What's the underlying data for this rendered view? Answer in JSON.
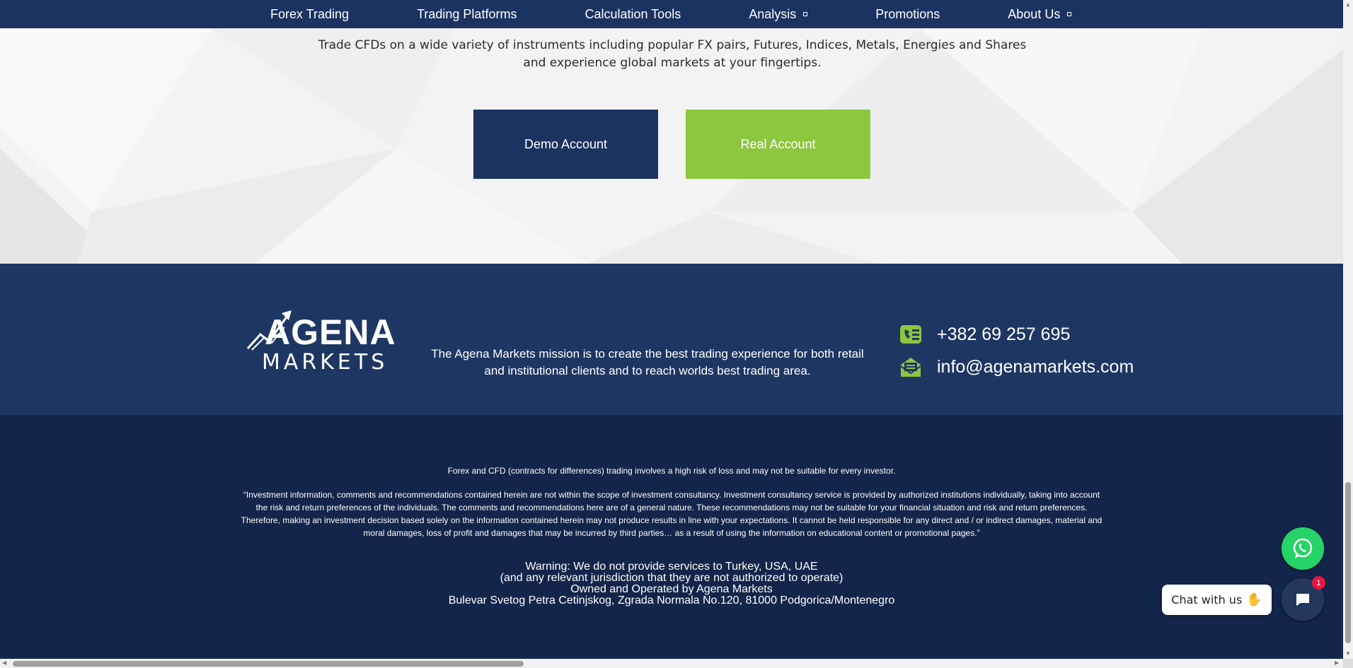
{
  "nav": {
    "items": [
      {
        "label": "Forex Trading",
        "has_dropdown": false
      },
      {
        "label": "Trading Platforms",
        "has_dropdown": false
      },
      {
        "label": "Calculation Tools",
        "has_dropdown": false
      },
      {
        "label": "Analysis",
        "has_dropdown": true
      },
      {
        "label": "Promotions",
        "has_dropdown": false
      },
      {
        "label": "About Us",
        "has_dropdown": true
      }
    ]
  },
  "hero": {
    "text": "Trade CFDs on a wide variety of instruments including popular FX pairs, Futures, Indices, Metals, Energies and Shares and experience global markets at your fingertips.",
    "demo_button": "Demo Account",
    "real_button": "Real Account"
  },
  "footer": {
    "logo_top": "AGENA",
    "logo_bottom": "MARKETS",
    "mission": "The Agena Markets mission is to create the best trading experience for both retail and institutional clients and to reach worlds best trading area.",
    "phone": "+382 69 257 695",
    "email": "info@agenamarkets.com",
    "risk_warning": "Forex and CFD (contracts for differences) trading involves a high risk of loss and may not be suitable for every investor.",
    "disclaimer": "“Investment information, comments and recommendations contained herein are not within the scope of investment consultancy. Investment consultancy service is provided by authorized institutions individually, taking into account the risk and return preferences of the individuals. The comments and recommendations here are of a general nature. These recommendations may not be suitable for your financial situation and risk and return preferences. Therefore, making an investment decision based solely on the information contained herein may not produce results in line with your expectations. It cannot be held responsible for any direct and / or indirect damages, material and moral damages, loss of profit and damages that may be incurred by third parties… as a result of using the information on educational content or promotional pages.”",
    "warning_lines": [
      "Warning: We do not provide services to Turkey, USA, UAE",
      "(and any relevant jurisdiction that they are not authorized to operate)",
      "Owned and Operated by Agena Markets",
      "Bulevar Svetog Petra Cetinjskog, Zgrada Normala No.120, 81000 Podgorica/Montenegro"
    ]
  },
  "widgets": {
    "chat_label": "Chat with us",
    "chat_badge": "1"
  },
  "colors": {
    "navy": "#1a3360",
    "green": "#8dc63f",
    "footer_top": "#1e3762",
    "footer_bottom": "#13254a",
    "whatsapp": "#25d366",
    "badge": "#e8173d"
  },
  "icons": [
    "phone-icon",
    "email-icon",
    "whatsapp-icon",
    "chat-icon",
    "wave-icon",
    "dropdown-caret-icon"
  ]
}
